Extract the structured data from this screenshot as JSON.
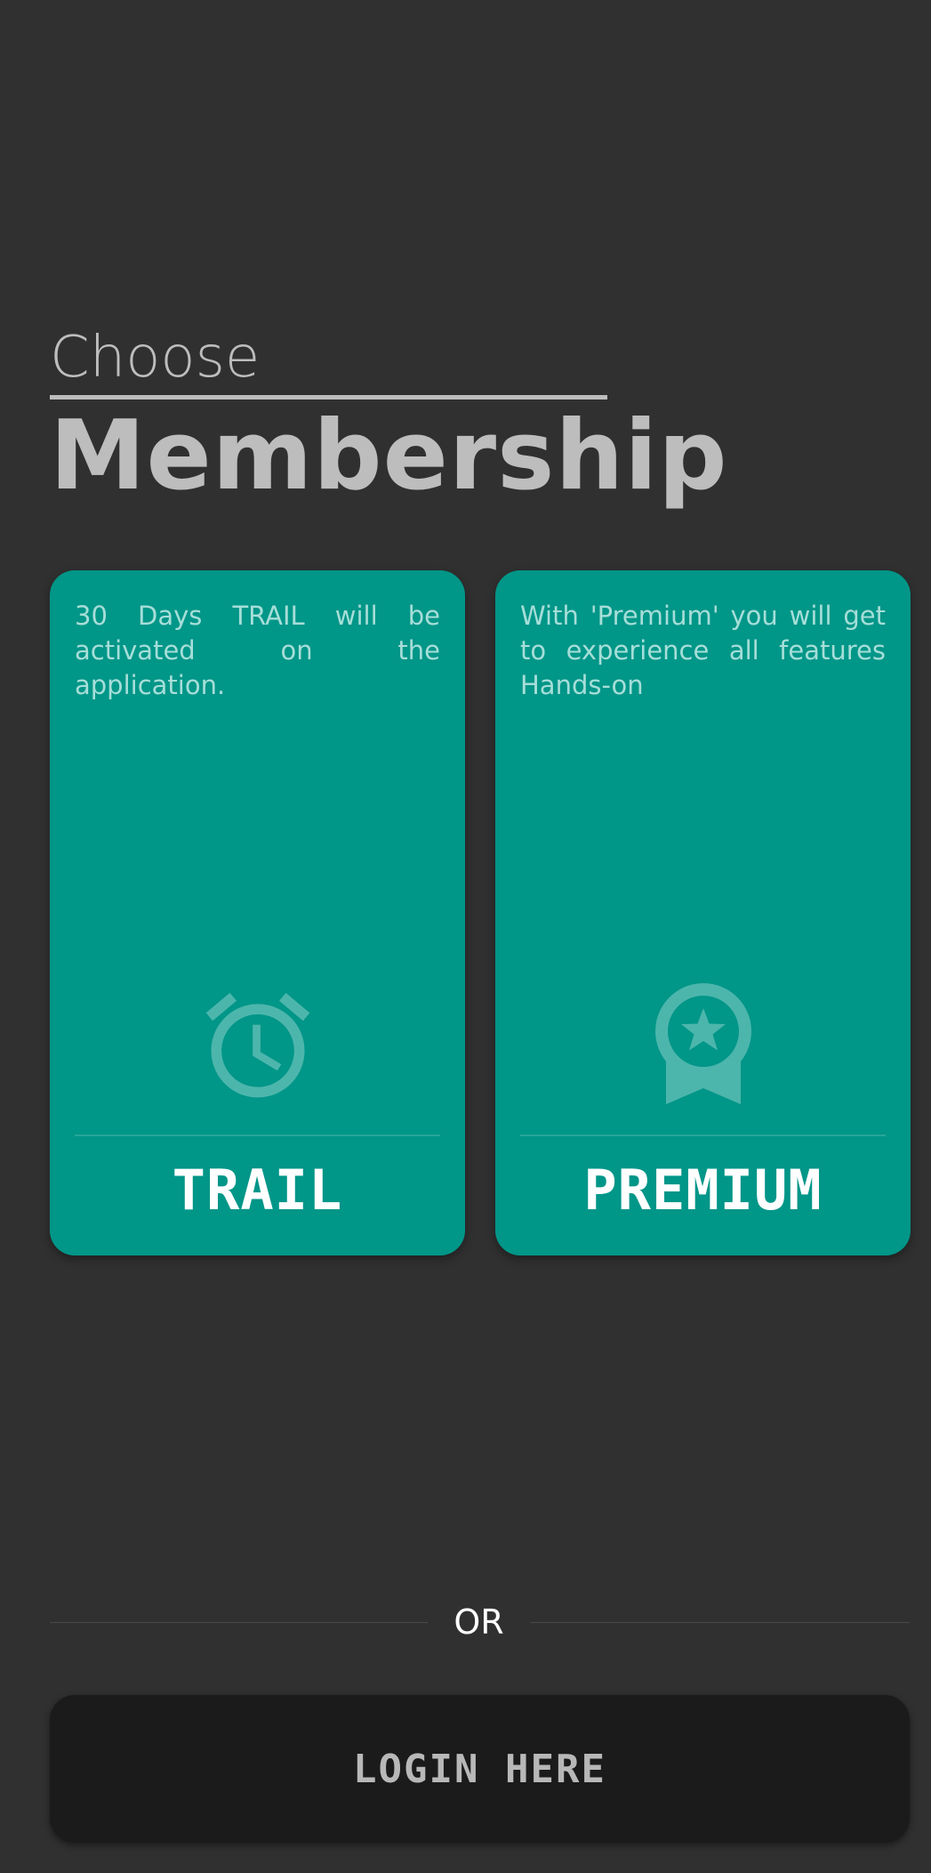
{
  "header": {
    "choose": "Choose",
    "membership": "Membership"
  },
  "plans": [
    {
      "description": "30 Days TRAIL will be activated on the application.",
      "icon": "alarm-clock-icon",
      "title": "TRAIL"
    },
    {
      "description": "With 'Premium' you will get to experience all features Hands-on",
      "icon": "award-badge-icon",
      "title": "PREMIUM"
    }
  ],
  "divider": {
    "or_text": "OR"
  },
  "login": {
    "label": "LOGIN HERE"
  },
  "colors": {
    "background": "#303030",
    "card": "#009688",
    "icon": "#4db6ac",
    "button": "#1b1b1b"
  }
}
